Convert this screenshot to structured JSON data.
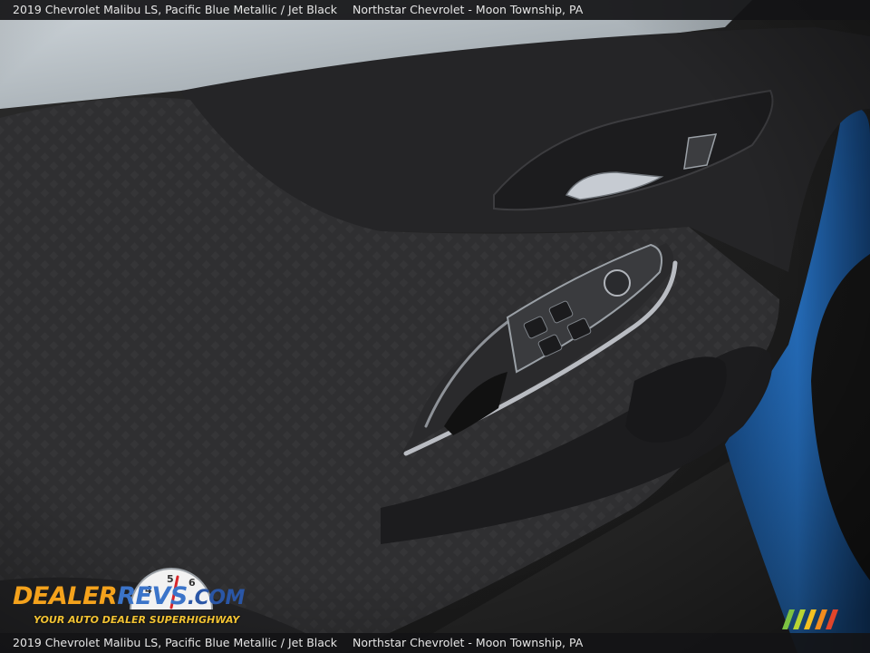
{
  "caption": {
    "vehicle": "2019 Chevrolet Malibu LS,  Pacific Blue Metallic / Jet Black",
    "dealer": "Northstar Chevrolet - Moon Township, PA"
  },
  "logo": {
    "dealer_part": "DEALER",
    "revs_part": "REVS",
    "com_part": ".COM",
    "tagline": "YOUR AUTO DEALER SUPERHIGHWAY",
    "dial_digits": [
      "4",
      "5",
      "6"
    ]
  },
  "colors": {
    "door_panel": "#2b2b2d",
    "trim_silver": "#b9bcc2",
    "body_blue": "#1e5fa8",
    "logo_orange": "#f4a21c",
    "logo_blue": "#3b74c9"
  }
}
